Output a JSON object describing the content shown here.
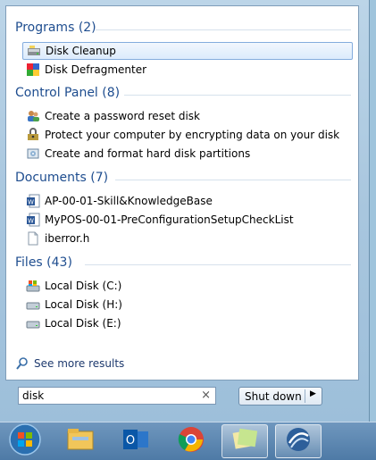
{
  "sections": {
    "programs": {
      "header": "Programs (2)",
      "items": [
        {
          "label": "Disk Cleanup",
          "icon": "disk-cleanup-icon",
          "selected": true
        },
        {
          "label": "Disk Defragmenter",
          "icon": "disk-defragmenter-icon"
        }
      ]
    },
    "control_panel": {
      "header": "Control Panel (8)",
      "items": [
        {
          "label": "Create a password reset disk",
          "icon": "users-icon"
        },
        {
          "label": "Protect your computer by encrypting data on your disk",
          "icon": "bitlocker-icon"
        },
        {
          "label": "Create and format hard disk partitions",
          "icon": "disk-management-icon"
        }
      ]
    },
    "documents": {
      "header": "Documents (7)",
      "items": [
        {
          "label": "AP-00-01-Skill&KnowledgeBase",
          "icon": "word-document-icon"
        },
        {
          "label": "MyPOS-00-01-PreConfigurationSetupCheckList",
          "icon": "word-document-icon"
        },
        {
          "label": "iberror.h",
          "icon": "text-file-icon"
        }
      ]
    },
    "files": {
      "header": "Files (43)",
      "items": [
        {
          "label": "Local Disk (C:)",
          "icon": "system-drive-icon"
        },
        {
          "label": "Local Disk (H:)",
          "icon": "hard-drive-icon"
        },
        {
          "label": "Local Disk (E:)",
          "icon": "hard-drive-icon"
        }
      ]
    }
  },
  "see_more": {
    "label": "See more results",
    "icon": "search-icon"
  },
  "search": {
    "value": "disk",
    "clear_glyph": "×"
  },
  "shutdown": {
    "label": "Shut down",
    "arrow_glyph": "▶"
  },
  "taskbar": {
    "buttons": [
      {
        "name": "start-orb-icon"
      },
      {
        "name": "file-explorer-icon"
      },
      {
        "name": "outlook-icon"
      },
      {
        "name": "chrome-icon"
      },
      {
        "name": "sticky-notes-icon"
      },
      {
        "name": "app-swirl-icon"
      }
    ]
  },
  "colors": {
    "accent": "#1e4d8f",
    "selection": "#dcebfc"
  }
}
